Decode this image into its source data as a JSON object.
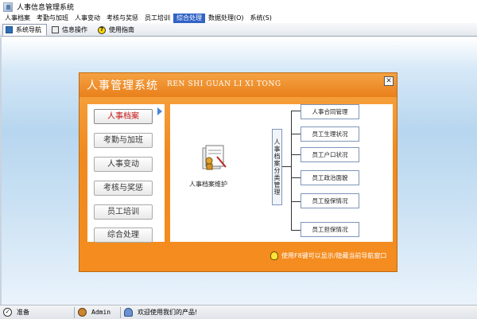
{
  "window": {
    "title": "人事信息管理系统"
  },
  "menubar": {
    "items": [
      {
        "label": "人事档案",
        "active": false
      },
      {
        "label": "考勤与加班",
        "active": false
      },
      {
        "label": "人事变动",
        "active": false
      },
      {
        "label": "考核与奖惩",
        "active": false
      },
      {
        "label": "员工培训",
        "active": false
      },
      {
        "label": "综合处理",
        "active": true
      },
      {
        "label": "数据处理(O)",
        "active": false
      },
      {
        "label": "系统(S)",
        "active": false
      }
    ]
  },
  "tabs": [
    {
      "label": "系统导航",
      "icon": "navigation-icon",
      "active": true
    },
    {
      "label": "信息操作",
      "icon": "info-operation-icon",
      "active": false
    },
    {
      "label": "使用指南",
      "icon": "help-icon",
      "active": false
    }
  ],
  "panel": {
    "title": "人事管理系统",
    "title_en": "REN SHI GUAN LI XI TONG",
    "close_icon": "close-icon",
    "left_menu": [
      {
        "label": "人事档案",
        "active": true
      },
      {
        "label": "考勤与加班",
        "active": false
      },
      {
        "label": "人事变动",
        "active": false
      },
      {
        "label": "考核与奖惩",
        "active": false
      },
      {
        "label": "员工培训",
        "active": false
      },
      {
        "label": "综合处理",
        "active": false
      }
    ],
    "content": {
      "main_label": "人事档案维护",
      "category_label": "人事档案分类管理",
      "items": [
        {
          "label": "人事合同管理"
        },
        {
          "label": "员工生理状况"
        },
        {
          "label": "员工户口状况"
        },
        {
          "label": "员工政治面貌"
        },
        {
          "label": "员工投保情况"
        },
        {
          "label": "员工担保情况"
        }
      ]
    },
    "footer_text": "使用F8键可以显示/隐藏当前导航窗口"
  },
  "statusbar": {
    "ready": "准备",
    "user": "Admin",
    "welcome": "欢迎使用我们的产品!"
  },
  "colors": {
    "panel_orange": "#f18a1e",
    "menu_active": "#3163c6",
    "active_left_item_text": "#c41616"
  }
}
